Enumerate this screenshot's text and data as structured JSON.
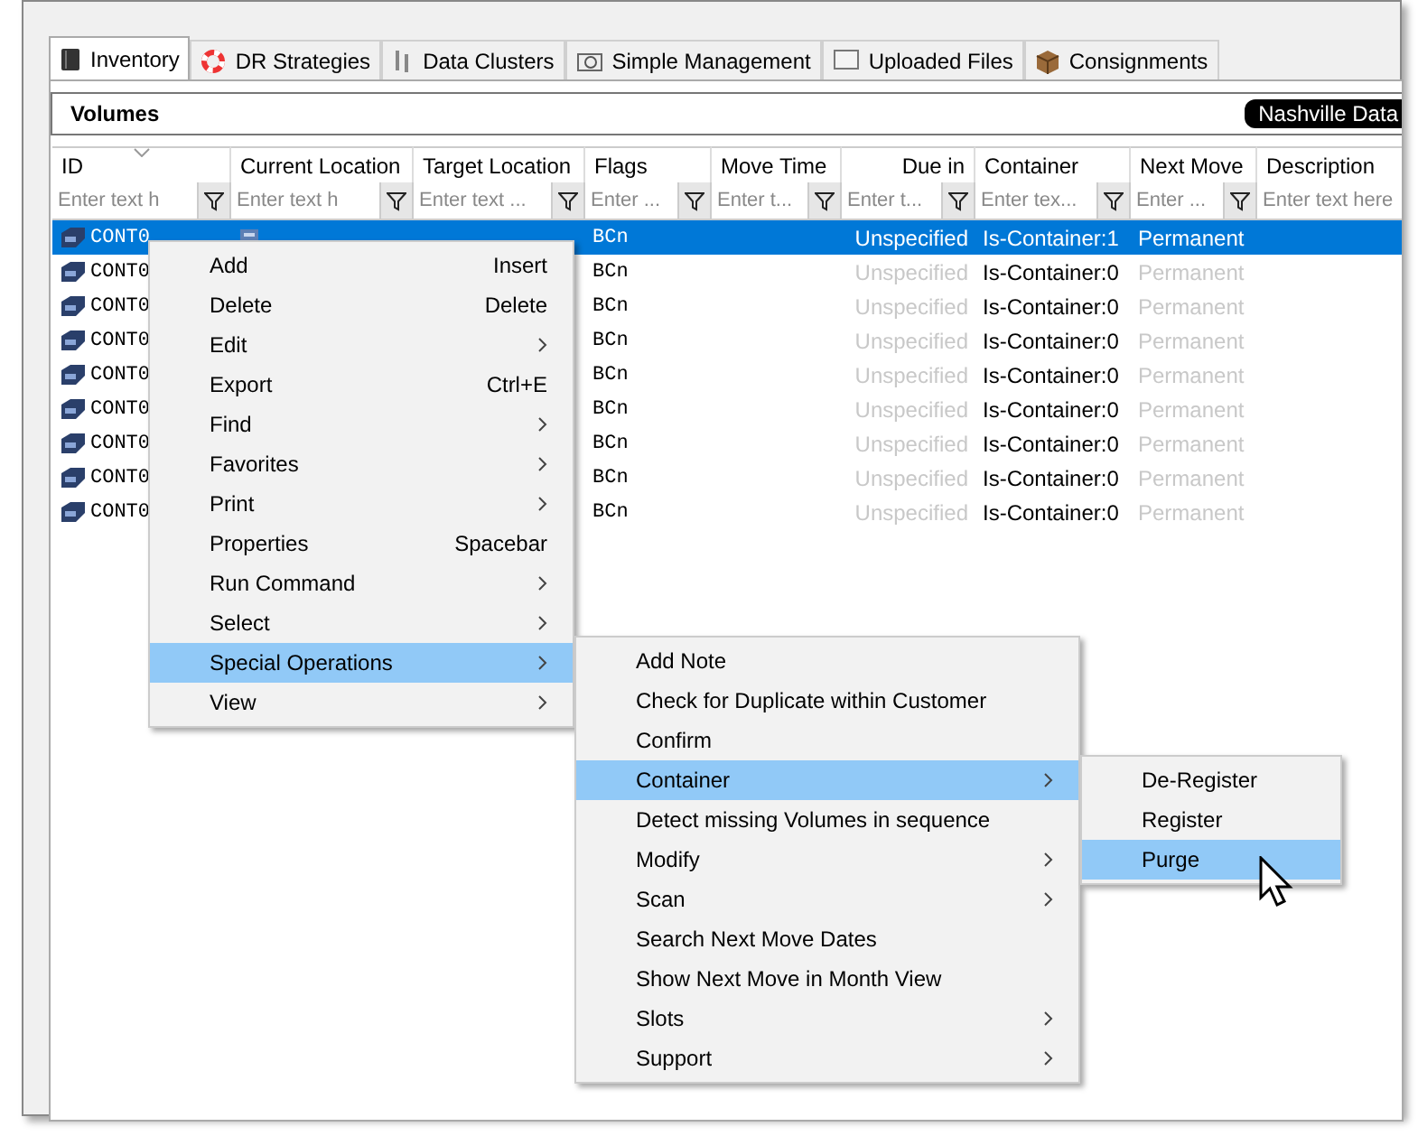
{
  "tabs": [
    {
      "label": "Inventory",
      "selected": true
    },
    {
      "label": "DR Strategies",
      "selected": false
    },
    {
      "label": "Data Clusters",
      "selected": false
    },
    {
      "label": "Simple Management",
      "selected": false
    },
    {
      "label": "Uploaded Files",
      "selected": false
    },
    {
      "label": "Consignments",
      "selected": false
    }
  ],
  "panel": {
    "title": "Volumes",
    "badge": "Nashville Data"
  },
  "table": {
    "columns": [
      {
        "label": "ID",
        "placeholder": "Enter text h",
        "sorted": true
      },
      {
        "label": "Current Location",
        "placeholder": "Enter text h",
        "sorted": false
      },
      {
        "label": "Target Location",
        "placeholder": "Enter text ...",
        "sorted": false
      },
      {
        "label": "Flags",
        "placeholder": "Enter ...",
        "sorted": false
      },
      {
        "label": "Move Time",
        "placeholder": "Enter t...",
        "sorted": false
      },
      {
        "label": "Due in",
        "placeholder": "Enter t...",
        "sorted": false
      },
      {
        "label": "Container",
        "placeholder": "Enter tex...",
        "sorted": false
      },
      {
        "label": "Next Move",
        "placeholder": "Enter ...",
        "sorted": false
      },
      {
        "label": "Description",
        "placeholder": "Enter text here",
        "sorted": false
      }
    ],
    "rows": [
      {
        "selected": true,
        "id": "CONT0",
        "flags": "BCn",
        "due_in": "Unspecified",
        "container": "Is-Container:1",
        "next_move": "Permanent"
      },
      {
        "selected": false,
        "id": "CONT0",
        "flags": "BCn",
        "due_in": "Unspecified",
        "container": "Is-Container:0",
        "next_move": "Permanent"
      },
      {
        "selected": false,
        "id": "CONT0",
        "flags": "BCn",
        "due_in": "Unspecified",
        "container": "Is-Container:0",
        "next_move": "Permanent"
      },
      {
        "selected": false,
        "id": "CONT0",
        "flags": "BCn",
        "due_in": "Unspecified",
        "container": "Is-Container:0",
        "next_move": "Permanent"
      },
      {
        "selected": false,
        "id": "CONT0",
        "flags": "BCn",
        "due_in": "Unspecified",
        "container": "Is-Container:0",
        "next_move": "Permanent"
      },
      {
        "selected": false,
        "id": "CONT0",
        "flags": "BCn",
        "due_in": "Unspecified",
        "container": "Is-Container:0",
        "next_move": "Permanent"
      },
      {
        "selected": false,
        "id": "CONT0",
        "flags": "BCn",
        "due_in": "Unspecified",
        "container": "Is-Container:0",
        "next_move": "Permanent"
      },
      {
        "selected": false,
        "id": "CONT0",
        "flags": "BCn",
        "due_in": "Unspecified",
        "container": "Is-Container:0",
        "next_move": "Permanent"
      },
      {
        "selected": false,
        "id": "CONT0",
        "flags": "BCn",
        "due_in": "Unspecified",
        "container": "Is-Container:0",
        "next_move": "Permanent"
      }
    ]
  },
  "context_menu": [
    {
      "label": "Add",
      "shortcut": "Insert",
      "submenu": false,
      "selected": false
    },
    {
      "label": "Delete",
      "shortcut": "Delete",
      "submenu": false,
      "selected": false
    },
    {
      "label": "Edit",
      "submenu": true,
      "selected": false
    },
    {
      "label": "Export",
      "shortcut": "Ctrl+E",
      "submenu": false,
      "selected": false
    },
    {
      "label": "Find",
      "submenu": true,
      "selected": false
    },
    {
      "label": "Favorites",
      "submenu": true,
      "selected": false
    },
    {
      "label": "Print",
      "submenu": true,
      "selected": false
    },
    {
      "label": "Properties",
      "shortcut": "Spacebar",
      "submenu": false,
      "selected": false
    },
    {
      "label": "Run Command",
      "submenu": true,
      "selected": false
    },
    {
      "label": "Select",
      "submenu": true,
      "selected": false
    },
    {
      "label": "Special Operations",
      "submenu": true,
      "selected": true
    },
    {
      "label": "View",
      "submenu": true,
      "selected": false
    }
  ],
  "special_operations_menu": [
    {
      "label": "Add Note",
      "submenu": false,
      "selected": false
    },
    {
      "label": "Check for Duplicate within Customer",
      "submenu": false,
      "selected": false
    },
    {
      "label": "Confirm",
      "submenu": false,
      "selected": false
    },
    {
      "label": "Container",
      "submenu": true,
      "selected": true
    },
    {
      "label": "Detect missing Volumes in sequence",
      "submenu": false,
      "selected": false
    },
    {
      "label": "Modify",
      "submenu": true,
      "selected": false
    },
    {
      "label": "Scan",
      "submenu": true,
      "selected": false
    },
    {
      "label": "Search Next Move Dates",
      "submenu": false,
      "selected": false
    },
    {
      "label": "Show Next Move in Month View",
      "submenu": false,
      "selected": false
    },
    {
      "label": "Slots",
      "submenu": true,
      "selected": false
    },
    {
      "label": "Support",
      "submenu": true,
      "selected": false
    }
  ],
  "container_menu": [
    {
      "label": "De-Register",
      "submenu": false,
      "selected": false
    },
    {
      "label": "Register",
      "submenu": false,
      "selected": false
    },
    {
      "label": "Purge",
      "submenu": false,
      "selected": true
    }
  ]
}
